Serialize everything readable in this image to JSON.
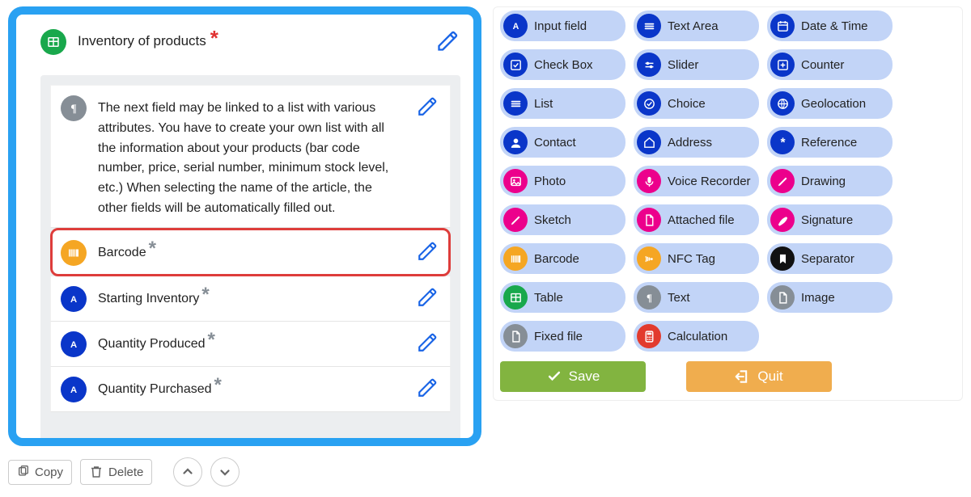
{
  "form": {
    "title": "Inventory of products",
    "fields": [
      {
        "kind": "paragraph",
        "icon": "paragraph-icon",
        "bg": "bg-gray",
        "text": "The next field may be linked to a list with various attributes. You have to create your own list with all the information about your products (bar code number, price, serial number, minimum stock level, etc.) When selecting the name of the article, the other fields will be automatically filled out."
      },
      {
        "kind": "input",
        "icon": "barcode-icon",
        "bg": "bg-orange",
        "label": "Barcode",
        "required": true,
        "selected": true
      },
      {
        "kind": "input",
        "icon": "letter-a-icon",
        "bg": "bg-blue",
        "label": "Starting Inventory",
        "required": true
      },
      {
        "kind": "input",
        "icon": "letter-a-icon",
        "bg": "bg-blue",
        "label": "Quantity Produced",
        "required": true
      },
      {
        "kind": "input",
        "icon": "letter-a-icon",
        "bg": "bg-blue",
        "label": "Quantity Purchased",
        "required": true
      }
    ]
  },
  "leftButtons": {
    "copy": "Copy",
    "delete": "Delete"
  },
  "palette": [
    {
      "label": "Input field",
      "icon": "letter-a-icon",
      "bg": "pbg-blue"
    },
    {
      "label": "Text Area",
      "icon": "lines-icon",
      "bg": "pbg-blue"
    },
    {
      "label": "Date & Time",
      "icon": "calendar-icon",
      "bg": "pbg-blue"
    },
    {
      "label": "Check Box",
      "icon": "checkbox-icon",
      "bg": "pbg-blue"
    },
    {
      "label": "Slider",
      "icon": "slider-icon",
      "bg": "pbg-blue"
    },
    {
      "label": "Counter",
      "icon": "plus-box-icon",
      "bg": "pbg-blue"
    },
    {
      "label": "List",
      "icon": "lines-icon",
      "bg": "pbg-blue"
    },
    {
      "label": "Choice",
      "icon": "check-circle-icon",
      "bg": "pbg-blue"
    },
    {
      "label": "Geolocation",
      "icon": "globe-icon",
      "bg": "pbg-blue"
    },
    {
      "label": "Contact",
      "icon": "user-icon",
      "bg": "pbg-blue"
    },
    {
      "label": "Address",
      "icon": "home-icon",
      "bg": "pbg-blue"
    },
    {
      "label": "Reference",
      "icon": "asterisk-icon",
      "bg": "pbg-blue"
    },
    {
      "label": "Photo",
      "icon": "image-icon",
      "bg": "pbg-pink"
    },
    {
      "label": "Voice Recorder",
      "icon": "mic-icon",
      "bg": "pbg-pink"
    },
    {
      "label": "Drawing",
      "icon": "pencil-icon",
      "bg": "pbg-pink"
    },
    {
      "label": "Sketch",
      "icon": "pencil-icon",
      "bg": "pbg-pink"
    },
    {
      "label": "Attached file",
      "icon": "file-icon",
      "bg": "pbg-pink"
    },
    {
      "label": "Signature",
      "icon": "pen-icon",
      "bg": "pbg-pink"
    },
    {
      "label": "Barcode",
      "icon": "barcode-icon",
      "bg": "pbg-orange"
    },
    {
      "label": "NFC Tag",
      "icon": "nfc-icon",
      "bg": "pbg-orange"
    },
    {
      "label": "Separator",
      "icon": "bookmark-icon",
      "bg": "pbg-black"
    },
    {
      "label": "Table",
      "icon": "table-icon",
      "bg": "pbg-green"
    },
    {
      "label": "Text",
      "icon": "paragraph-icon",
      "bg": "pbg-gray"
    },
    {
      "label": "Image",
      "icon": "file-icon",
      "bg": "pbg-gray"
    },
    {
      "label": "Fixed file",
      "icon": "file-icon",
      "bg": "pbg-gray"
    },
    {
      "label": "Calculation",
      "icon": "calculator-icon",
      "bg": "pbg-red"
    }
  ],
  "bottomButtons": {
    "save": "Save",
    "quit": "Quit"
  }
}
